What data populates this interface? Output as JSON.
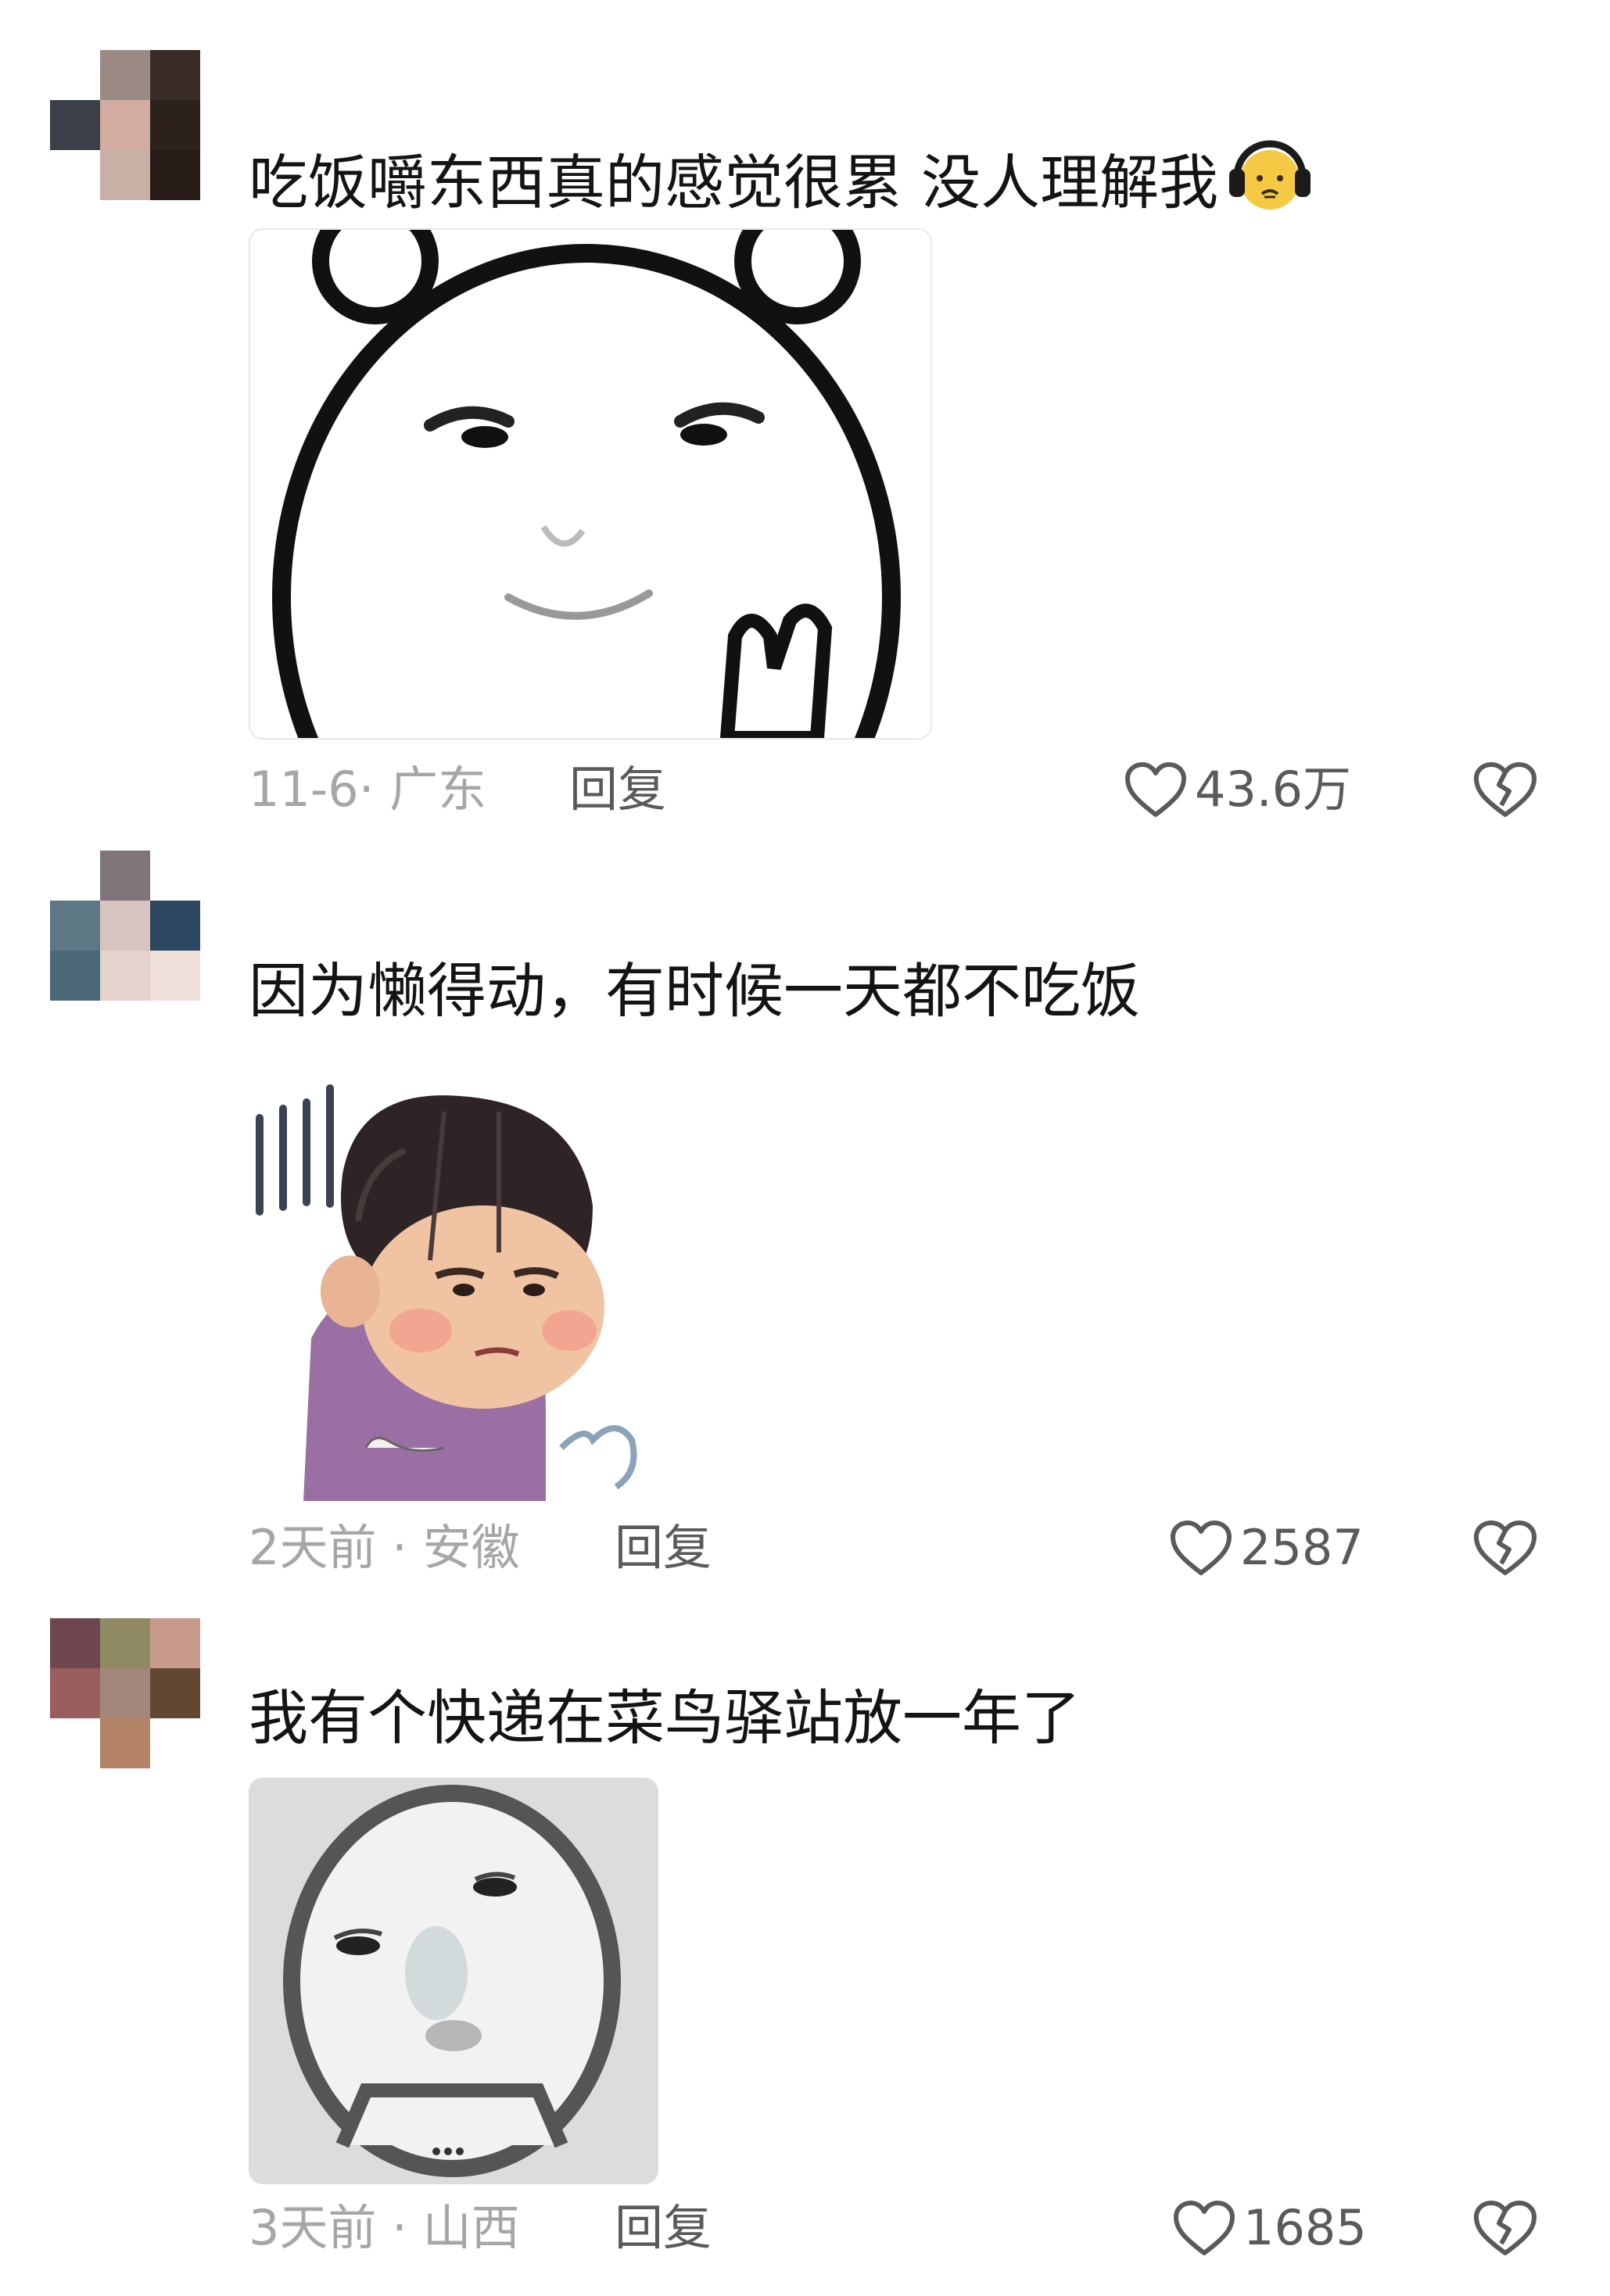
{
  "comments": [
    {
      "text": "吃饭嚼东西真的感觉很累 没人理解我",
      "emoji_icon": "headphones-sad-face-emoji",
      "sticker_icon": "smug-bear-meme-sticker",
      "meta": "11-6· 广东",
      "reply_label": "回复",
      "likes": "43.6万"
    },
    {
      "text": "因为懒得动，有时候一天都不吃饭",
      "sticker_icon": "exhausted-person-meme-sticker",
      "meta": "2天前 · 安徽",
      "reply_label": "回复",
      "likes": "2587"
    },
    {
      "text": "我有个快递在菜鸟驿站放一年了",
      "sticker_icon": "blurry-face-meme-sticker",
      "meta": "3天前 · 山西",
      "reply_label": "回复",
      "likes": "1685"
    }
  ],
  "icons": {
    "like": "heart-outline-icon",
    "dislike": "broken-heart-icon"
  }
}
